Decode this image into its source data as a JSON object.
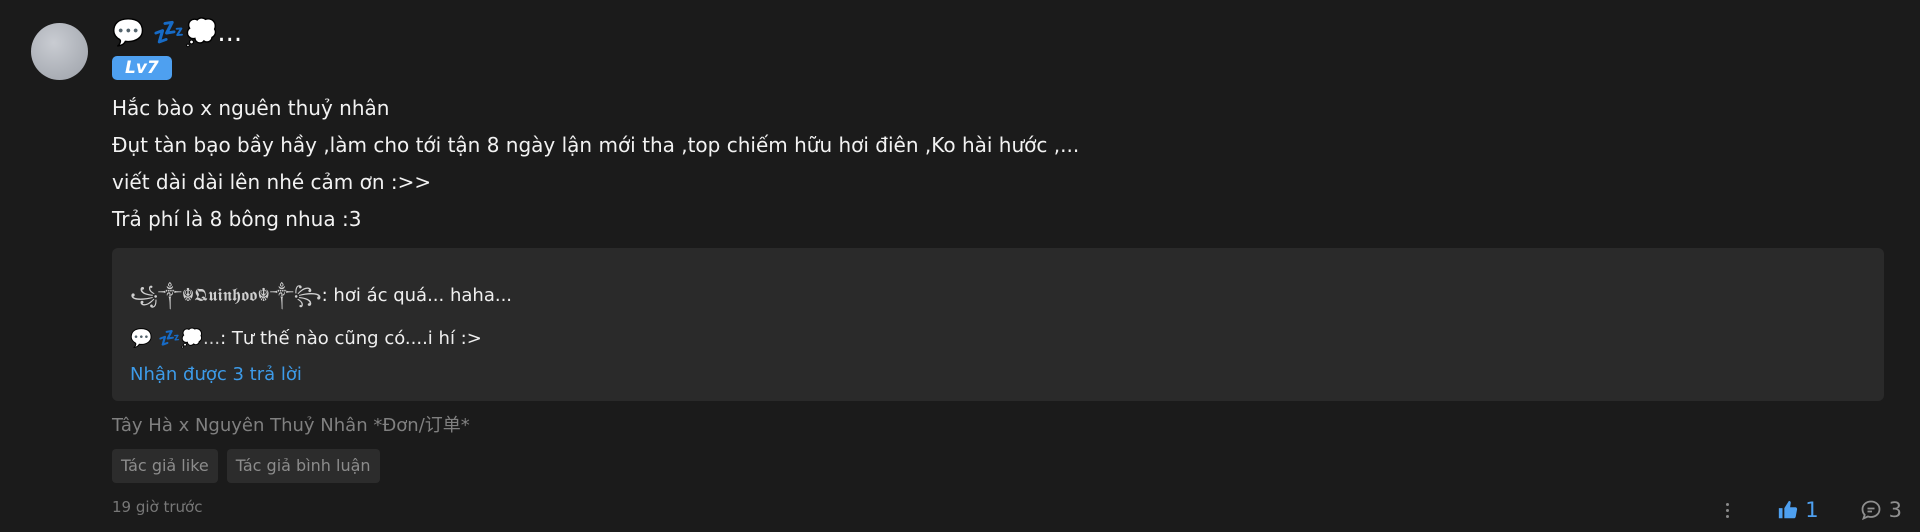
{
  "comment": {
    "username": "💬 💤💭...",
    "level": "Lv7",
    "body": [
      "Hắc bào x nguên thuỷ nhân",
      "Đụt tàn bạo bầy hầy ,làm cho tới tận 8 ngày lận mới tha ,top chiếm hữu hơi điên ,Ko hài hước ,...",
      "viết dài dài lên nhé cảm ơn :>>",
      "Trả phí là 8 bông nhua :3"
    ],
    "replies": [
      {
        "author": "꧁༒☬𝕼𝖚𝖎𝖓𝖍𝖔𝖔☬༒꧂",
        "text": ": hơi ác quá... haha..."
      },
      {
        "author": "💬 💤💭...",
        "text": ": Tư thế nào cũng có....i hí :>"
      }
    ],
    "reply_count_label": "Nhận được 3 trả lời",
    "context": "Tây Hà x Nguyên Thuỷ Nhân *Đơn/订单*",
    "tags": [
      "Tác giả like",
      "Tác giả bình luận"
    ],
    "timestamp": "19 giờ trước",
    "likes": "1",
    "reply_total": "3"
  },
  "colors": {
    "background": "#1b1b1b",
    "accent": "#4ea0f0",
    "reply_box": "#2a2a2a",
    "link": "#3d9be9"
  },
  "icons": {
    "more": "vertical-dots-icon",
    "like": "thumbs-up-icon",
    "reply": "comment-bubble-icon"
  }
}
